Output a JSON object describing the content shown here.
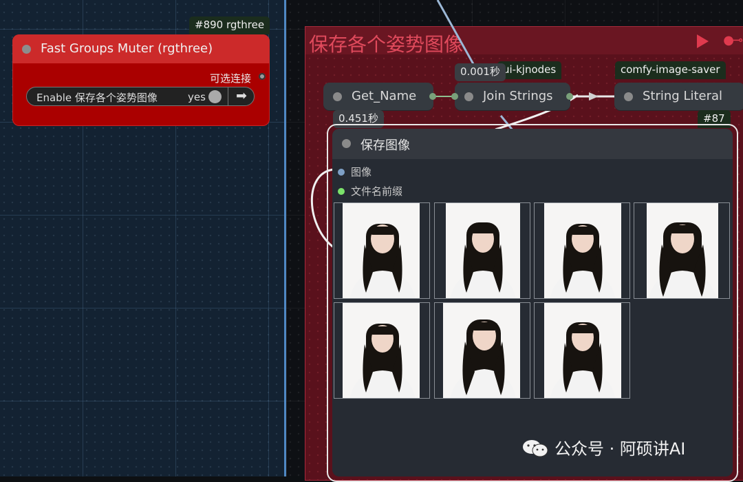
{
  "fast_groups_muter": {
    "badge": "#890 rgthree",
    "title": "Fast Groups Muter (rgthree)",
    "optional_output": "可选连接",
    "toggle_label": "Enable 保存各个姿势图像",
    "toggle_value": "yes"
  },
  "group": {
    "title": "保存各个姿势图像",
    "colors": {
      "fill": "#5a111c",
      "accent": "#e03a4e"
    }
  },
  "timing_badge_1": "0.001秒",
  "timing_badge_2": "0.451秒",
  "nodes": {
    "get_name": {
      "label": "Get_Name"
    },
    "join_strings": {
      "label": "Join Strings",
      "badge": "ui-kjnodes"
    },
    "string_literal": {
      "label": "String Literal",
      "badge": "comfy-image-saver"
    }
  },
  "save_image": {
    "badge": "#87",
    "title": "保存图像",
    "inputs": [
      {
        "label": "图像",
        "color": "#7ea0c6"
      },
      {
        "label": "文件名前缀",
        "color": "#7be36b"
      }
    ],
    "thumbnails_count": 7
  },
  "watermark": {
    "text": "公众号 · 阿硕讲AI",
    "icon": "wechat-icon"
  }
}
